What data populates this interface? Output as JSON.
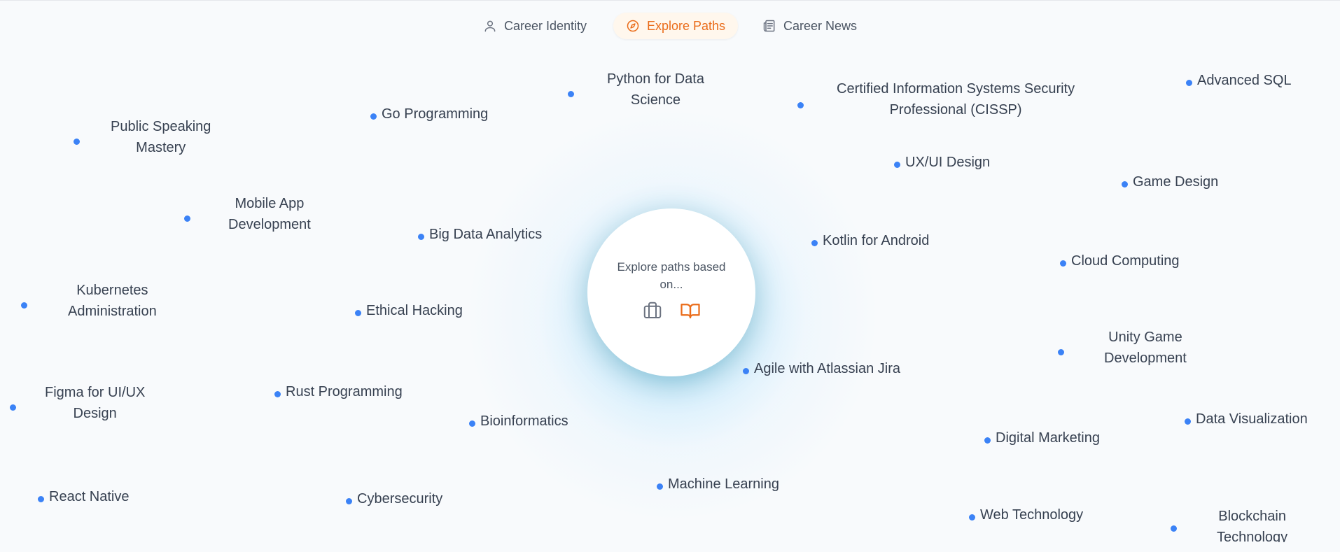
{
  "tabs": [
    {
      "label": "Career Identity",
      "icon": "user-icon"
    },
    {
      "label": "Explore Paths",
      "icon": "compass-icon",
      "active": true
    },
    {
      "label": "Career News",
      "icon": "newspaper-icon"
    }
  ],
  "center": {
    "prompt": "Explore paths based on...",
    "icons": [
      "briefcase-icon",
      "book-open-icon"
    ]
  },
  "colors": {
    "accent": "#ea6c1a",
    "dot": "#3b82f6",
    "glow": "#7dd3fc"
  },
  "paths": [
    {
      "label": "Python for Data Science",
      "lines": [
        "Python for Data",
        "Science"
      ]
    },
    {
      "label": "Certified Information Systems Security Professional (CISSP)",
      "lines": [
        "Certified Information Systems Security",
        "Professional (CISSP)"
      ]
    },
    {
      "label": "Advanced SQL",
      "lines": [
        "Advanced SQL"
      ]
    },
    {
      "label": "Go Programming",
      "lines": [
        "Go Programming"
      ]
    },
    {
      "label": "Public Speaking Mastery",
      "lines": [
        "Public Speaking",
        "Mastery"
      ]
    },
    {
      "label": "UX/UI Design",
      "lines": [
        "UX/UI Design"
      ]
    },
    {
      "label": "Game Design",
      "lines": [
        "Game Design"
      ]
    },
    {
      "label": "Mobile App Development",
      "lines": [
        "Mobile App",
        "Development"
      ]
    },
    {
      "label": "Big Data Analytics",
      "lines": [
        "Big Data Analytics"
      ]
    },
    {
      "label": "Kotlin for Android",
      "lines": [
        "Kotlin for Android"
      ]
    },
    {
      "label": "Cloud Computing",
      "lines": [
        "Cloud Computing"
      ]
    },
    {
      "label": "Kubernetes Administration",
      "lines": [
        "Kubernetes",
        "Administration"
      ]
    },
    {
      "label": "Ethical Hacking",
      "lines": [
        "Ethical Hacking"
      ]
    },
    {
      "label": "Unity Game Development",
      "lines": [
        "Unity Game",
        "Development"
      ]
    },
    {
      "label": "Agile with Atlassian Jira",
      "lines": [
        "Agile with Atlassian Jira"
      ]
    },
    {
      "label": "Figma for UI/UX Design",
      "lines": [
        "Figma for UI/UX",
        "Design"
      ]
    },
    {
      "label": "Rust Programming",
      "lines": [
        "Rust Programming"
      ]
    },
    {
      "label": "Bioinformatics",
      "lines": [
        "Bioinformatics"
      ]
    },
    {
      "label": "Data Visualization",
      "lines": [
        "Data Visualization"
      ]
    },
    {
      "label": "Digital Marketing",
      "lines": [
        "Digital Marketing"
      ]
    },
    {
      "label": "React Native",
      "lines": [
        "React Native"
      ]
    },
    {
      "label": "Cybersecurity",
      "lines": [
        "Cybersecurity"
      ]
    },
    {
      "label": "Machine Learning",
      "lines": [
        "Machine Learning"
      ]
    },
    {
      "label": "Web Technology",
      "lines": [
        "Web Technology"
      ]
    },
    {
      "label": "Blockchain Technology",
      "lines": [
        "Blockchain",
        "Technology"
      ]
    }
  ]
}
